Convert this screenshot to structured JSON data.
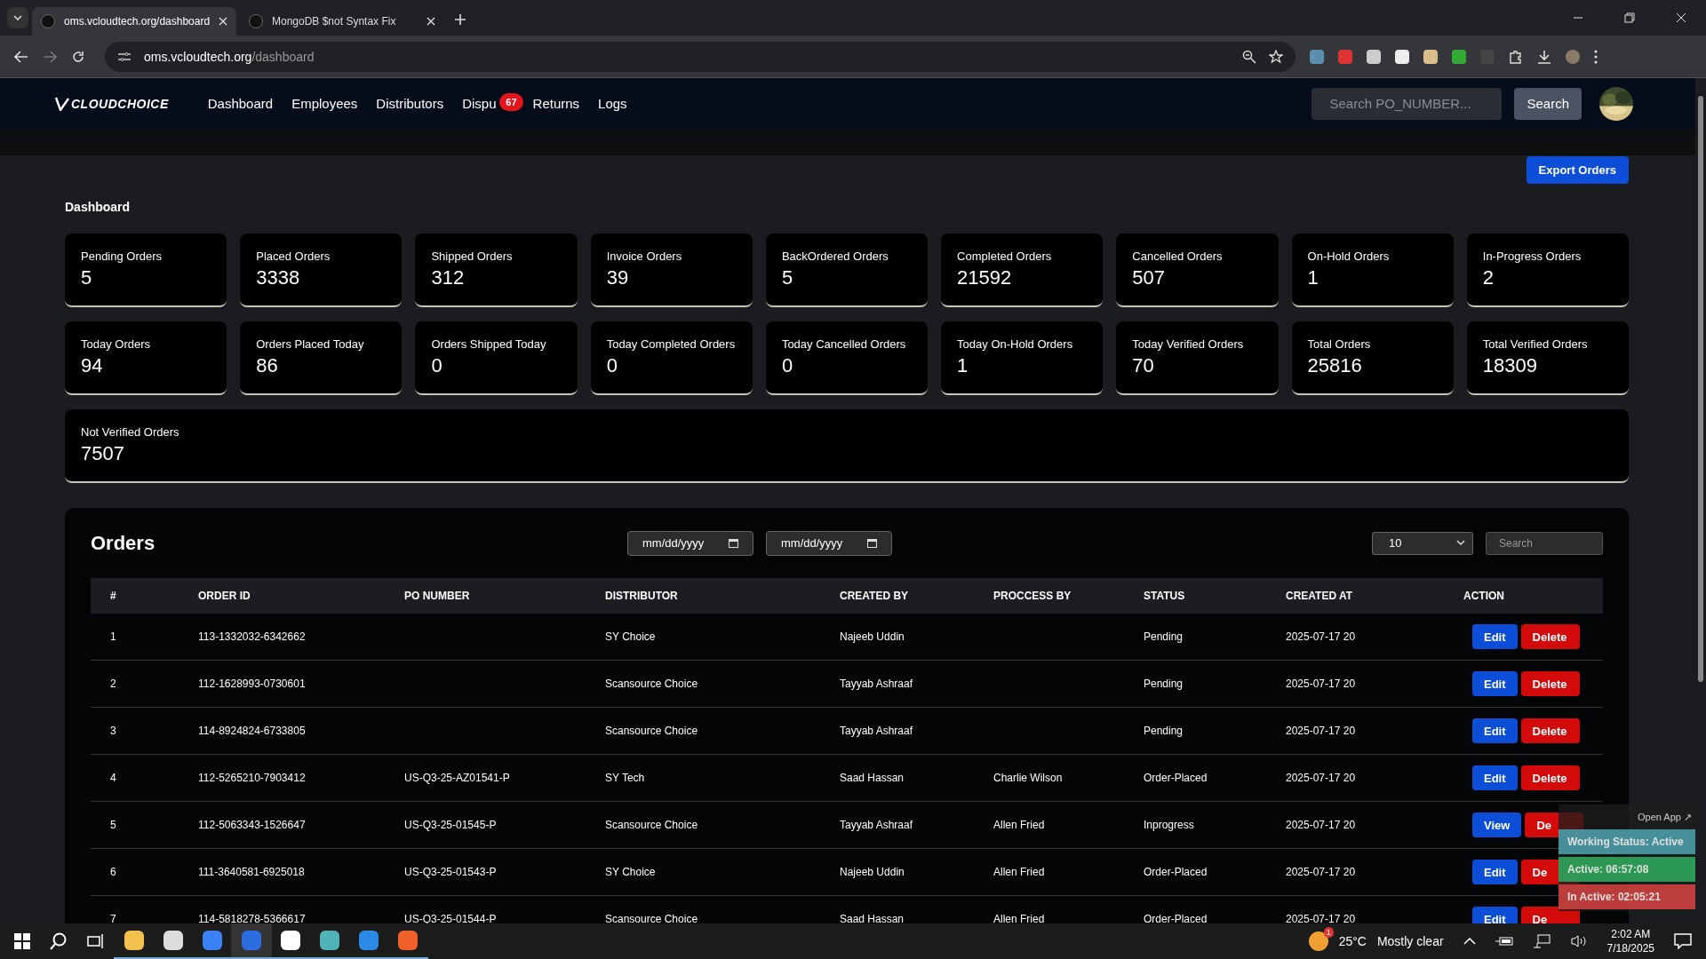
{
  "browser": {
    "tabs": [
      {
        "title": "oms.vcloudtech.org/dashboard",
        "selected": true
      },
      {
        "title": "MongoDB $not Syntax Fix",
        "selected": false
      }
    ],
    "url_host": "oms.vcloudtech.org",
    "url_path": "/dashboard"
  },
  "nav": {
    "brand": "CLOUDCHOICE",
    "links": [
      {
        "label": "Dashboard"
      },
      {
        "label": "Employees"
      },
      {
        "label": "Distributors"
      },
      {
        "label": "Dispu",
        "badge": "67"
      },
      {
        "label": "Returns"
      },
      {
        "label": "Logs"
      }
    ],
    "search_placeholder": "Search PO_NUMBER...",
    "search_button": "Search"
  },
  "export_button": "Export Orders",
  "page_title": "Dashboard",
  "stats": [
    {
      "label": "Pending Orders",
      "value": "5",
      "kind": "card"
    },
    {
      "label": "Placed Orders",
      "value": "3338",
      "kind": "card"
    },
    {
      "label": "Shipped Orders",
      "value": "312",
      "kind": "card"
    },
    {
      "label": "Invoice Orders",
      "value": "39",
      "kind": "card"
    },
    {
      "label": "BackOrdered Orders",
      "value": "5",
      "kind": "card"
    },
    {
      "label": "Completed Orders",
      "value": "21592",
      "kind": "card"
    },
    {
      "label": "Cancelled Orders",
      "value": "507",
      "kind": "card"
    },
    {
      "label": "On-Hold Orders",
      "value": "1",
      "kind": "card"
    },
    {
      "label": "In-Progress Orders",
      "value": "2",
      "kind": "card"
    },
    {
      "label": "Today Orders",
      "value": "94",
      "kind": "card"
    },
    {
      "label": "Orders Placed Today",
      "value": "86",
      "kind": "card"
    },
    {
      "label": "Orders Shipped Today",
      "value": "0",
      "kind": "card"
    },
    {
      "label": "Today Completed Orders",
      "value": "0",
      "kind": "card"
    },
    {
      "label": "Today Cancelled Orders",
      "value": "0",
      "kind": "card"
    },
    {
      "label": "Today On-Hold Orders",
      "value": "1",
      "kind": "card"
    },
    {
      "label": "Today Verified Orders",
      "value": "70",
      "kind": "card"
    },
    {
      "label": "Total Orders",
      "value": "25816",
      "kind": "card"
    },
    {
      "label": "Total Verified Orders",
      "value": "18309",
      "kind": "card"
    },
    {
      "label": "Not Verified Orders",
      "value": "7507",
      "kind": "wide"
    }
  ],
  "orders": {
    "title": "Orders",
    "date_placeholders": [
      "mm/dd/yyyy",
      "mm/dd/yyyy"
    ],
    "page_size": "10",
    "search_placeholder": "Search",
    "columns": [
      "#",
      "ORDER ID",
      "PO NUMBER",
      "DISTRIBUTOR",
      "CREATED BY",
      "PROCCESS BY",
      "STATUS",
      "CREATED AT",
      "ACTION"
    ],
    "rows": [
      {
        "cells": [
          "1",
          "113-1332032-6342662",
          "",
          "SY Choice",
          "Najeeb Uddin",
          "",
          "Pending",
          "2025-07-17 20"
        ],
        "primary": "Edit",
        "secondary": "Delete"
      },
      {
        "cells": [
          "2",
          "112-1628993-0730601",
          "",
          "Scansource Choice",
          "Tayyab Ashraaf",
          "",
          "Pending",
          "2025-07-17 20"
        ],
        "primary": "Edit",
        "secondary": "Delete"
      },
      {
        "cells": [
          "3",
          "114-8924824-6733805",
          "",
          "Scansource Choice",
          "Tayyab Ashraaf",
          "",
          "Pending",
          "2025-07-17 20"
        ],
        "primary": "Edit",
        "secondary": "Delete"
      },
      {
        "cells": [
          "4",
          "112-5265210-7903412",
          "US-Q3-25-AZ01541-P",
          "SY Tech",
          "Saad Hassan",
          "Charlie Wilson",
          "Order-Placed",
          "2025-07-17 20"
        ],
        "primary": "Edit",
        "secondary": "Delete"
      },
      {
        "cells": [
          "5",
          "112-5063343-1526647",
          "US-Q3-25-01545-P",
          "Scansource Choice",
          "Tayyab Ashraaf",
          "Allen Fried",
          "Inprogress",
          "2025-07-17 20"
        ],
        "primary": "View",
        "secondary": "De"
      },
      {
        "cells": [
          "6",
          "111-3640581-6925018",
          "US-Q3-25-01543-P",
          "SY Choice",
          "Najeeb Uddin",
          "Allen Fried",
          "Order-Placed",
          "2025-07-17 20"
        ],
        "primary": "Edit",
        "secondary": "De"
      },
      {
        "cells": [
          "7",
          "114-5818278-5366617",
          "US-Q3-25-01544-P",
          "Scansource Choice",
          "Saad Hassan",
          "Allen Fried",
          "Order-Placed",
          "2025-07-17 20"
        ],
        "primary": "Edit",
        "secondary": "De"
      }
    ]
  },
  "tracker": {
    "open_app": "Open App ↗",
    "statuses": [
      {
        "label": "Working Status: Active",
        "color": "#4a9aa5"
      },
      {
        "label": "Active: 06:57:08",
        "color": "#2ea35a"
      },
      {
        "label": "In Active: 02:05:21",
        "color": "#c9413f"
      }
    ]
  },
  "taskbar": {
    "weather_badge": "1",
    "temperature": "25°C",
    "weather": "Mostly clear",
    "time": "2:02 AM",
    "date": "7/18/2025"
  }
}
